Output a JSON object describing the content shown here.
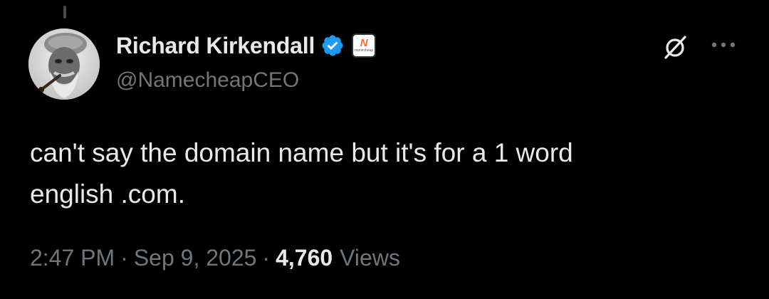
{
  "author": {
    "display_name": "Richard Kirkendall",
    "handle": "@NamecheapCEO",
    "verified_color": "#1d9bf0",
    "affiliate_mark": "N",
    "affiliate_word": "namecheap"
  },
  "tweet": {
    "text": "can't say the domain name but it's for a 1 word\nenglish .com."
  },
  "meta": {
    "time": "2:47 PM",
    "separator": "·",
    "date": "Sep 9, 2025",
    "views_count": "4,760",
    "views_label": "Views"
  },
  "actions": {
    "grok_icon": "grok-icon",
    "more_icon": "more-horizontal-icon"
  }
}
